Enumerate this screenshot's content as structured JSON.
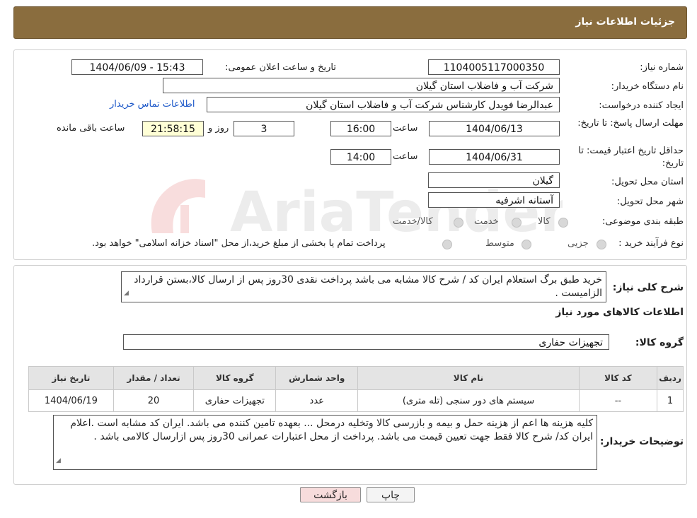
{
  "header": {
    "title": "جزئیات اطلاعات نیاز"
  },
  "watermark": {
    "text": "AriaTender.neT"
  },
  "form": {
    "need_number": {
      "label": "شماره نیاز:",
      "value": "1104005117000350"
    },
    "announce_datetime": {
      "label": "تاریخ و ساعت اعلان عمومی:",
      "value": "1404/06/09 - 15:43"
    },
    "buyer_org": {
      "label": "نام دستگاه خریدار:",
      "value": "شرکت آب و فاضلاب استان گیلان"
    },
    "requester": {
      "label": "ایجاد کننده درخواست:",
      "value": "عبدالرضا فویدل کارشناس شرکت آب و فاضلاب استان گیلان",
      "contact_link": "اطلاعات تماس خریدار"
    },
    "reply_deadline": {
      "label": "مهلت ارسال پاسخ: تا تاریخ:",
      "date": "1404/06/13",
      "time_label": "ساعت",
      "time": "16:00",
      "days": "3",
      "days_label": "روز و",
      "remaining": "21:58:15",
      "remaining_label": "ساعت باقی مانده"
    },
    "price_validity": {
      "label": "حداقل تاریخ اعتبار قیمت: تا تاریخ:",
      "date": "1404/06/31",
      "time_label": "ساعت",
      "time": "14:00"
    },
    "delivery_province": {
      "label": "استان محل تحویل:",
      "value": "گیلان"
    },
    "delivery_city": {
      "label": "شهر محل تحویل:",
      "value": "آستانه اشرفیه"
    },
    "category": {
      "label": "طبقه بندی موضوعی:",
      "options": [
        "کالا",
        "خدمت",
        "کالا/خدمت"
      ]
    },
    "process_type": {
      "label": "نوع فرآیند خرید :",
      "options": [
        "جزیی",
        "متوسط"
      ],
      "note": "پرداخت تمام یا بخشی از مبلغ خرید،از محل \"اسناد خزانه اسلامی\" خواهد بود."
    }
  },
  "description": {
    "label": "شرح کلی نیاز:",
    "text": "خرید طبق برگ استعلام ایران کد / شرح کالا مشابه می باشد پرداخت نقدی 30روز پس از ارسال کالا،بستن قرارداد الزامیست ."
  },
  "goods_info": {
    "title": "اطلاعات کالاهای مورد نیاز",
    "group_label": "گروه کالا:",
    "group_value": "تجهیزات حفاری",
    "columns": [
      "ردیف",
      "کد کالا",
      "نام کالا",
      "واحد شمارش",
      "گروه کالا",
      "تعداد / مقدار",
      "تاریخ نیاز"
    ],
    "rows": [
      [
        "1",
        "--",
        "سیستم های دور سنجی (تله متری)",
        "عدد",
        "تجهیزات حفاری",
        "20",
        "1404/06/19"
      ]
    ]
  },
  "buyer_notes": {
    "label": "توضیحات خریدار:",
    "text": "کلیه هزینه ها اعم از هزینه حمل و بیمه و بازرسی کالا وتخلیه درمحل ... بعهده تامین کننده می باشد. ایران کد مشابه است .اعلام ایران کد/ شرح کالا فقط جهت تعیین قیمت می باشد. پرداخت از محل اعتبارات عمرانی 30روز  پس ازارسال کالامی باشد ."
  },
  "buttons": {
    "print": "چاپ",
    "back": "بازگشت"
  },
  "colors": {
    "header_bg": "#8a6d3e",
    "link": "#1a56c8",
    "remaining_bg": "#ffffd6",
    "back_btn_bg": "#f7dcdc"
  }
}
